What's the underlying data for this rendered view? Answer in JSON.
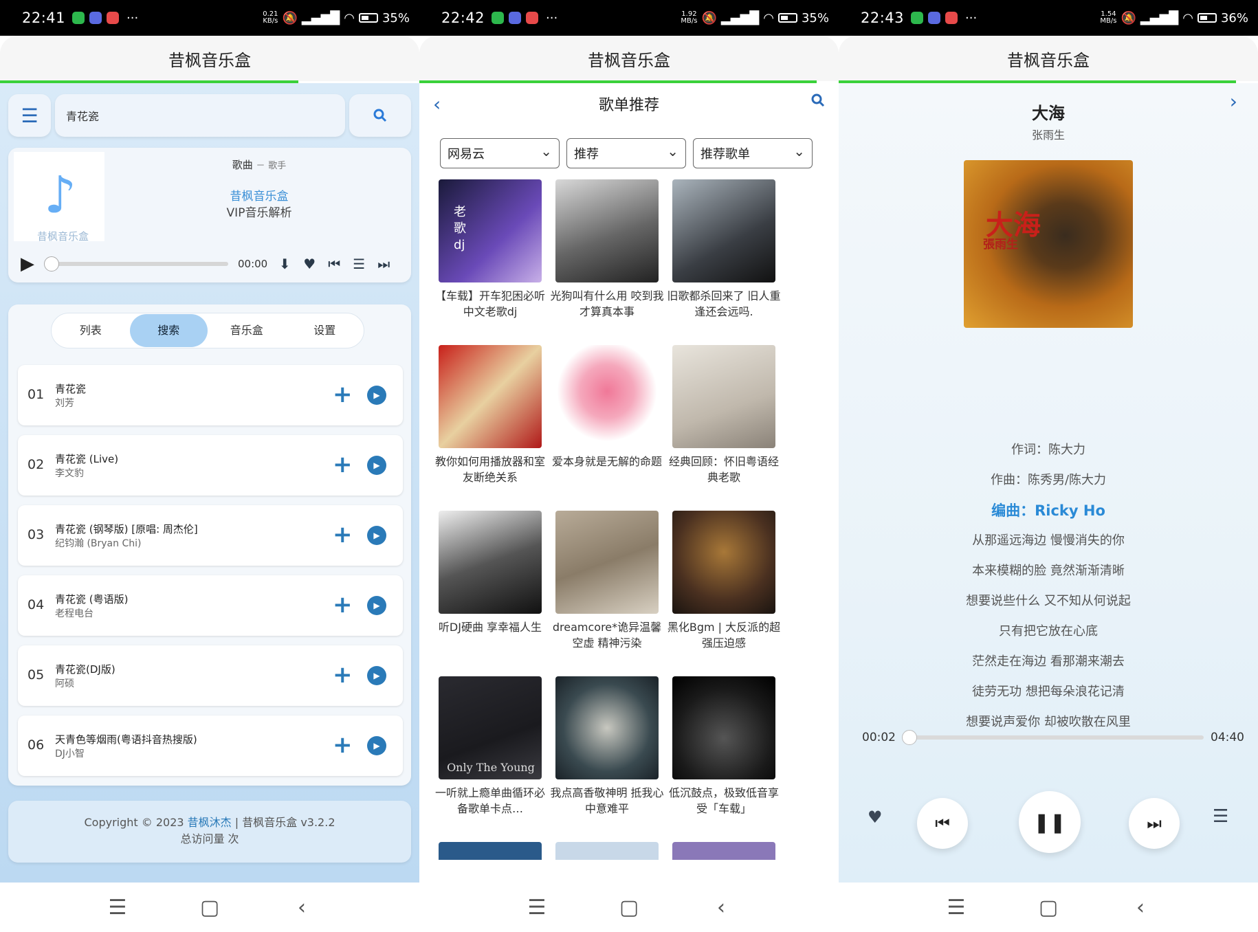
{
  "screens": [
    {
      "status": {
        "time": "22:41",
        "speed_top": "0.21",
        "speed_unit": "KB/s",
        "battery": "35%"
      },
      "app_title": "昔枫音乐盒",
      "search": {
        "value": "青花瓷"
      },
      "player": {
        "song": "歌曲",
        "sep": "－",
        "artist": "歌手",
        "line1": "昔枫音乐盒",
        "line2": "VIP音乐解析",
        "logo_text": "昔枫音乐盒",
        "time": "00:00"
      },
      "tabs": [
        {
          "label": "列表"
        },
        {
          "label": "搜索"
        },
        {
          "label": "音乐盒"
        },
        {
          "label": "设置"
        }
      ],
      "results": [
        {
          "num": "01",
          "title": "青花瓷",
          "artist": "刘芳"
        },
        {
          "num": "02",
          "title": "青花瓷 (Live)",
          "artist": "李文豹"
        },
        {
          "num": "03",
          "title": "青花瓷 (钢琴版) [原唱: 周杰伦]",
          "artist": "纪钧瀚 (Bryan Chi)"
        },
        {
          "num": "04",
          "title": "青花瓷 (粤语版)",
          "artist": "老程电台"
        },
        {
          "num": "05",
          "title": "青花瓷(DJ版)",
          "artist": "阿硕"
        },
        {
          "num": "06",
          "title": "天青色等烟雨(粤语抖音热搜版)",
          "artist": "DJ小智"
        }
      ],
      "footer": {
        "copyright": "Copyright © 2023",
        "author": "昔枫沐杰",
        "rest": " | 昔枫音乐盒 v3.2.2",
        "visits": "总访问量 次"
      }
    },
    {
      "status": {
        "time": "22:42",
        "speed_top": "1.92",
        "speed_unit": "MB/s",
        "battery": "35%"
      },
      "app_title": "昔枫音乐盒",
      "page_title": "歌单推荐",
      "selects": [
        "网易云",
        "推荐",
        "推荐歌单"
      ],
      "playlists": [
        {
          "caption": "【车载】开车犯困必听中文老歌dj",
          "cover_text": "老歌dj"
        },
        {
          "caption": "光狗叫有什么用 咬到我才算真本事"
        },
        {
          "caption": "旧歌都杀回来了 旧人重逢还会远吗."
        },
        {
          "caption": "教你如何用播放器和室友断绝关系"
        },
        {
          "caption": "爱本身就是无解的命题"
        },
        {
          "caption": "经典回顾：怀旧粤语经典老歌"
        },
        {
          "caption": "听DJ硬曲 享幸福人生"
        },
        {
          "caption": "dreamcore*诡异温馨 空虚 精神污染"
        },
        {
          "caption": "黑化Bgm | 大反派的超强压迫感"
        },
        {
          "caption": "一听就上瘾单曲循环必备歌单卡点…",
          "cover_text": "Only The Young"
        },
        {
          "caption": "我点高香敬神明 抵我心中意难平"
        },
        {
          "caption": "低沉鼓点，极致低音享受「车载」"
        }
      ]
    },
    {
      "status": {
        "time": "22:43",
        "speed_top": "1.54",
        "speed_unit": "MB/s",
        "battery": "36%"
      },
      "app_title": "昔枫音乐盒",
      "song_title": "大海",
      "artist": "张雨生",
      "album_text": "張雨生",
      "album_big": "大海",
      "lyrics": [
        "作词：陈大力",
        "作曲：陈秀男/陈大力",
        "编曲：Ricky Ho",
        "从那遥远海边 慢慢消失的你",
        "本来模糊的脸 竟然渐渐清晰",
        "想要说些什么 又不知从何说起",
        "只有把它放在心底",
        "茫然走在海边 看那潮来潮去",
        "徒劳无功 想把每朵浪花记清",
        "想要说声爱你 却被吹散在风里"
      ],
      "current_lyric": 2,
      "elapsed": "00:02",
      "duration": "04:40",
      "progress_fraction": 0.007
    }
  ],
  "colors": {
    "accent": "#2a7ab8",
    "green_bar": "#3ad13a"
  }
}
